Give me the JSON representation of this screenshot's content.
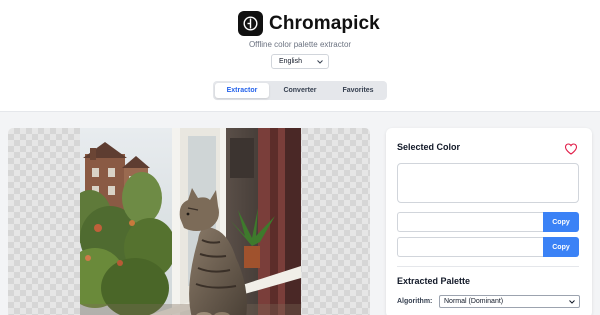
{
  "app": {
    "title": "Chromapick",
    "subtitle": "Offline color palette extractor",
    "language": "English",
    "logo_icon": "color-picker-clock-icon"
  },
  "tabs": [
    {
      "label": "Extractor",
      "active": true
    },
    {
      "label": "Converter",
      "active": false
    },
    {
      "label": "Favorites",
      "active": false
    }
  ],
  "image": {
    "description_icon": "cat-window-photo"
  },
  "sidebar": {
    "selected_color_title": "Selected Color",
    "favorite_icon": "heart-icon",
    "color_value_1": "",
    "color_value_2": "",
    "copy_label_1": "Copy",
    "copy_label_2": "Copy",
    "palette_title": "Extracted Palette",
    "algorithm_label": "Algorithm:",
    "algorithm_value": "Normal (Dominant)"
  },
  "colors": {
    "accent": "#3b82f6",
    "active_tab_text": "#2563eb",
    "heart": "#e11d48"
  }
}
